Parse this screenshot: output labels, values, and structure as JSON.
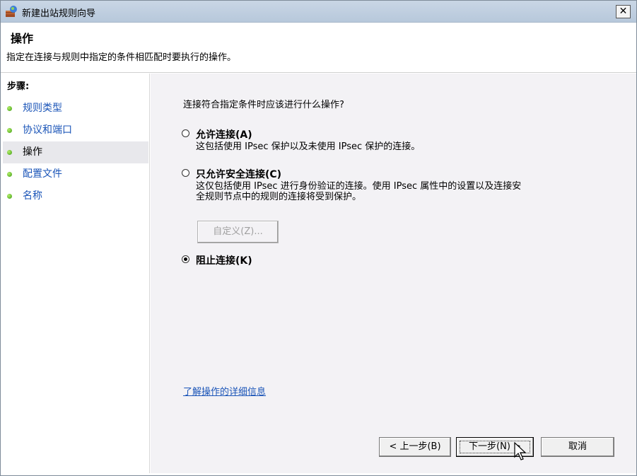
{
  "window": {
    "title": "新建出站规则向导",
    "close_label": "✕"
  },
  "header": {
    "title": "操作",
    "description": "指定在连接与规则中指定的条件相匹配时要执行的操作。"
  },
  "sidebar": {
    "steps_label": "步骤:",
    "items": [
      {
        "label": "规则类型",
        "active": false
      },
      {
        "label": "协议和端口",
        "active": false
      },
      {
        "label": "操作",
        "active": true
      },
      {
        "label": "配置文件",
        "active": false
      },
      {
        "label": "名称",
        "active": false
      }
    ]
  },
  "content": {
    "question": "连接符合指定条件时应该进行什么操作?",
    "options": [
      {
        "label": "允许连接(A)",
        "description": [
          "这包括使用 IPsec 保护以及未使用 IPsec 保护的连接。"
        ],
        "selected": false
      },
      {
        "label": "只允许安全连接(C)",
        "description": [
          "这仅包括使用 IPsec 进行身份验证的连接。使用 IPsec 属性中的设置以及连接安",
          "全规则节点中的规则的连接将受到保护。"
        ],
        "selected": false
      },
      {
        "label": "阻止连接(K)",
        "description": [],
        "selected": true
      }
    ],
    "customize_label": "自定义(Z)...",
    "help_link": "了解操作的详细信息"
  },
  "buttons": {
    "back": "< 上一步(B)",
    "next": "下一步(N) >",
    "cancel": "取消"
  },
  "colors": {
    "link": "#1b55b8",
    "content_bg": "#f3f2f5",
    "titlebar": "#c3d1e2"
  }
}
